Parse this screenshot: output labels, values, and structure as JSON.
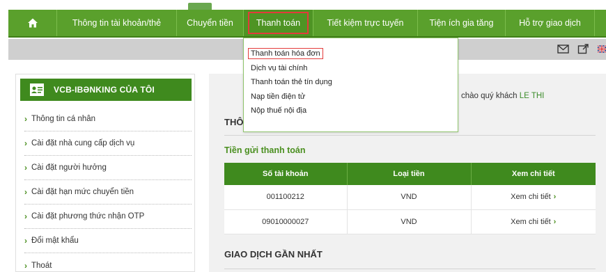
{
  "nav": {
    "items": [
      {
        "label": "Thông tin tài khoản/thẻ"
      },
      {
        "label": "Chuyển tiền"
      },
      {
        "label": "Thanh toán"
      },
      {
        "label": "Tiết kiệm trực tuyến"
      },
      {
        "label": "Tiện ích gia tăng"
      },
      {
        "label": "Hỗ trợ giao dịch"
      }
    ],
    "active": "Thanh toán",
    "home_icon": "home-icon"
  },
  "dropdown": {
    "items": [
      {
        "label": "Thanh toán hóa đơn"
      },
      {
        "label": "Dịch vụ tài chính"
      },
      {
        "label": "Thanh toán thẻ tín dụng"
      },
      {
        "label": "Nạp tiền điện tử"
      },
      {
        "label": "Nộp thuế nội địa"
      }
    ]
  },
  "sidebar": {
    "title": "VCB-IBƏNKING CỦA TÔI",
    "items": [
      {
        "label": "Thông tin cá nhân"
      },
      {
        "label": "Cài đặt nhà cung cấp dịch vụ"
      },
      {
        "label": "Cài đặt người hưởng"
      },
      {
        "label": "Cài đặt hạn mức chuyển tiền"
      },
      {
        "label": "Cài đặt phương thức nhận OTP"
      },
      {
        "label": "Đổi mật khẩu"
      },
      {
        "label": "Thoát"
      }
    ]
  },
  "main": {
    "greeting_prefix": "chào quý khách",
    "greeting_name": "LE THI",
    "title_partial": "THÔ",
    "section_title": "Tiền gửi thanh toán",
    "table": {
      "headers": [
        "Số tài khoản",
        "Loại tiền",
        "Xem chi tiết"
      ],
      "rows": [
        {
          "account": "001100212",
          "currency": "VND",
          "detail": "Xem chi tiết"
        },
        {
          "account": "09010000027",
          "currency": "VND",
          "detail": "Xem chi tiết"
        }
      ]
    },
    "recent_title": "GIAO DỊCH GẦN NHẤT"
  },
  "colors": {
    "nav_green": "#5aa02c",
    "header_green": "#3f8a1e",
    "highlight_red": "#e33b3b",
    "link_green": "#4a8f1f"
  }
}
